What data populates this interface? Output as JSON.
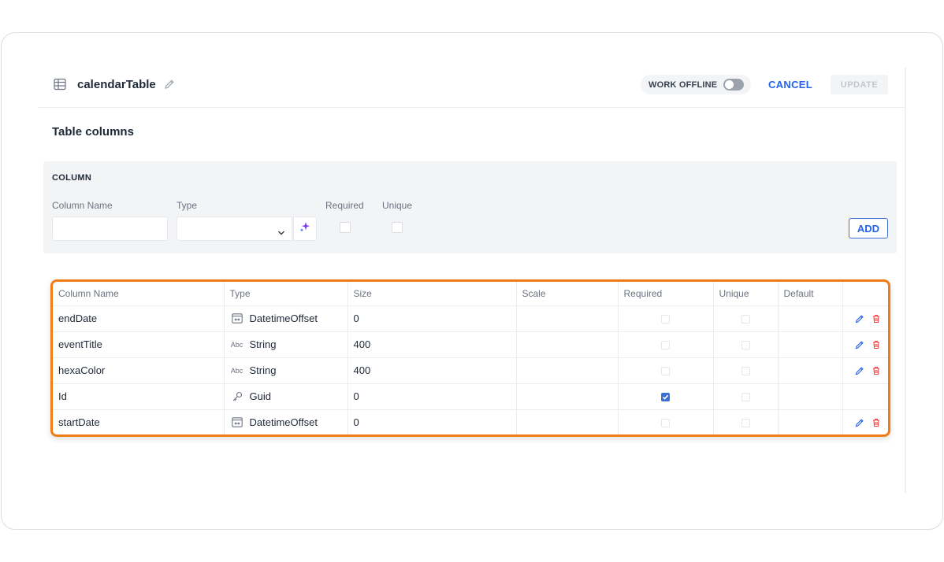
{
  "header": {
    "title": "calendarTable",
    "offline_label": "WORK OFFLINE",
    "offline_enabled": false,
    "cancel_label": "CANCEL",
    "update_label": "UPDATE"
  },
  "section_title": "Table columns",
  "add_column": {
    "heading": "COLUMN",
    "name_label": "Column Name",
    "name_value": "",
    "type_label": "Type",
    "type_value": "",
    "required_label": "Required",
    "unique_label": "Unique",
    "add_label": "ADD"
  },
  "table": {
    "headers": [
      "Column Name",
      "Type",
      "Size",
      "Scale",
      "Required",
      "Unique",
      "Default"
    ],
    "rows": [
      {
        "name": "endDate",
        "type": "DatetimeOffset",
        "type_icon": "datetime-icon",
        "size": "0",
        "scale": "",
        "required": false,
        "unique": false,
        "default": "",
        "editable": true
      },
      {
        "name": "eventTitle",
        "type": "String",
        "type_icon": "abc-icon",
        "size": "400",
        "scale": "",
        "required": false,
        "unique": false,
        "default": "",
        "editable": true
      },
      {
        "name": "hexaColor",
        "type": "String",
        "type_icon": "abc-icon",
        "size": "400",
        "scale": "",
        "required": false,
        "unique": false,
        "default": "",
        "editable": true
      },
      {
        "name": "Id",
        "type": "Guid",
        "type_icon": "key-icon",
        "size": "0",
        "scale": "",
        "required": true,
        "unique": false,
        "default": "",
        "editable": false
      },
      {
        "name": "startDate",
        "type": "DatetimeOffset",
        "type_icon": "datetime-icon",
        "size": "0",
        "scale": "",
        "required": false,
        "unique": false,
        "default": "",
        "editable": true
      }
    ],
    "abc_glyph": "Abc"
  },
  "colors": {
    "accent": "#2563eb",
    "highlight": "#f17c16",
    "delete": "#ef4444"
  }
}
